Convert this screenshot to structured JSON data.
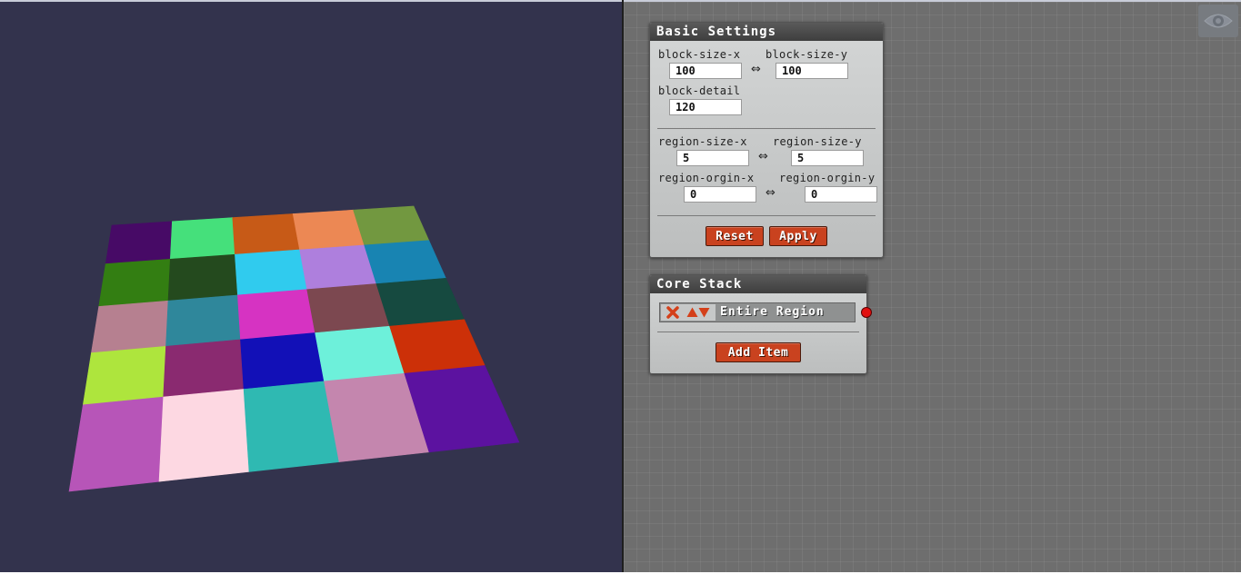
{
  "basic_settings": {
    "title": "Basic Settings",
    "block_size_x": {
      "label": "block-size-x",
      "value": "100"
    },
    "block_size_y": {
      "label": "block-size-y",
      "value": "100"
    },
    "block_detail": {
      "label": "block-detail",
      "value": "120"
    },
    "region_size_x": {
      "label": "region-size-x",
      "value": "5"
    },
    "region_size_y": {
      "label": "region-size-y",
      "value": "5"
    },
    "region_origin_x": {
      "label": "region-orgin-x",
      "value": "0"
    },
    "region_origin_y": {
      "label": "region-orgin-y",
      "value": "0"
    },
    "link_glyph": "⇔",
    "reset_label": "Reset",
    "apply_label": "Apply"
  },
  "core_stack": {
    "title": "Core Stack",
    "items": [
      {
        "label": "Entire Region",
        "icons": [
          "close-icon",
          "move-up-icon",
          "move-down-icon"
        ]
      }
    ],
    "add_item_label": "Add Item",
    "output_connector_color": "#e11010"
  },
  "toolbar": {
    "visibility_icon": "eye-icon"
  },
  "viewport": {
    "background": "#33334d",
    "grid_rows": 5,
    "grid_cols": 5,
    "tile_colors": [
      [
        "#470a66",
        "#45e07b",
        "#c75a17",
        "#ec8854",
        "#729840"
      ],
      [
        "#337e12",
        "#244a1e",
        "#30cbee",
        "#ae7fdd",
        "#1884b2"
      ],
      [
        "#b68090",
        "#2f879b",
        "#d633c2",
        "#7c4850",
        "#164a40"
      ],
      [
        "#aee53d",
        "#8a2a70",
        "#1210b7",
        "#6df0da",
        "#cc3008"
      ],
      [
        "#b755b8",
        "#fdd8e2",
        "#2fb9b2",
        "#c486ae",
        "#5c12a0"
      ]
    ]
  }
}
